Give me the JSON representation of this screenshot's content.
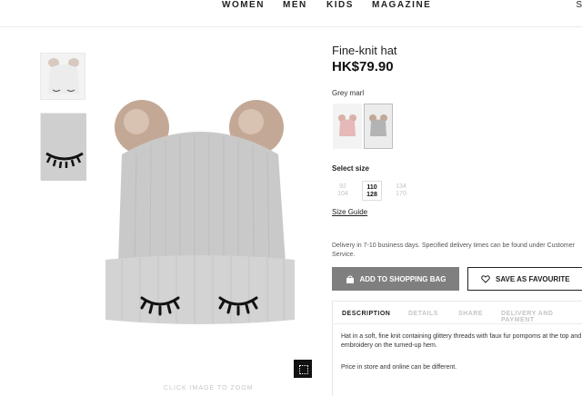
{
  "nav": {
    "items": [
      "WOMEN",
      "MEN",
      "KIDS",
      "MAGAZINE"
    ],
    "cut_text": "S"
  },
  "gallery": {
    "zoom_hint": "CLICK IMAGE TO ZOOM",
    "zoom_icon": "expand-icon"
  },
  "product": {
    "name": "Fine-knit hat",
    "price": "HK$79.90",
    "colour_label": "Grey marl",
    "colours": [
      {
        "name": "pink",
        "hex": "#e6b8b8"
      },
      {
        "name": "grey",
        "hex": "#b3b3b3"
      }
    ],
    "select_size_label": "Select size",
    "sizes": [
      {
        "top": "92",
        "bottom": "104"
      },
      {
        "top": "110",
        "bottom": "128"
      },
      {
        "top": "134",
        "bottom": "170"
      }
    ],
    "size_guide": "Size Guide",
    "delivery": "Delivery in 7-10 business days. Specified delivery times can be found under Customer Service.",
    "add_to_bag": "ADD TO SHOPPING BAG",
    "save_favourite": "SAVE AS FAVOURITE"
  },
  "details": {
    "tabs": [
      "DESCRIPTION",
      "DETAILS",
      "SHARE",
      "DELIVERY AND PAYMENT"
    ],
    "description": "Hat in a soft, fine knit containing glittery threads with faux fur pompoms at the top and embroidery on the turned-up hem.",
    "price_note": "Price in store and online can be different."
  },
  "colors": {
    "hat_grey": "#c9c9c9",
    "pompom": "#c4a896",
    "button_grey": "#7f7f7f"
  }
}
